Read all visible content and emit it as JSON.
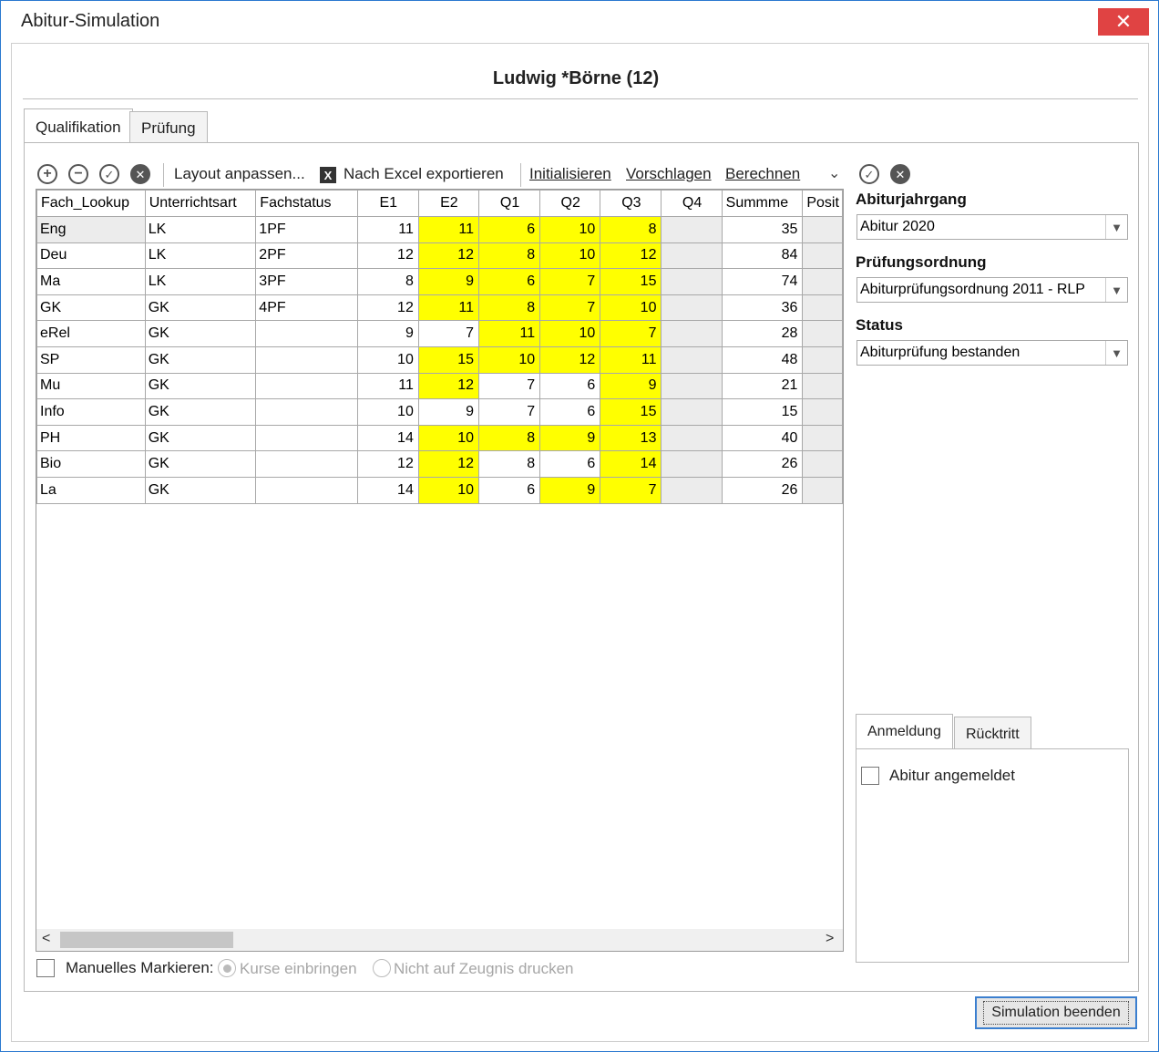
{
  "window": {
    "title": "Abitur-Simulation",
    "close_glyph": "✕"
  },
  "student": {
    "name": "Ludwig *Börne (12)"
  },
  "tabs": [
    {
      "label": "Qualifikation"
    },
    {
      "label": "Prüfung"
    }
  ],
  "toolbar": {
    "layout_label": "Layout anpassen...",
    "excel_icon": "X",
    "excel_label": "Nach Excel exportieren",
    "init_label": "Initialisieren",
    "suggest_label": "Vorschlagen",
    "calc_label": "Berechnen",
    "icons": [
      "add-icon",
      "remove-icon",
      "confirm-icon",
      "cancel-icon",
      "chevron-down-icon",
      "confirm-icon",
      "cancel-icon"
    ]
  },
  "grid": {
    "columns": [
      "Fach_Lookup",
      "Unterrichtsart",
      "Fachstatus",
      "E1",
      "E2",
      "Q1",
      "Q2",
      "Q3",
      "Q4",
      "Summme",
      "Posit"
    ],
    "rows": [
      {
        "fach": "Eng",
        "art": "LK",
        "status": "1PF",
        "E1": "11",
        "E2": "11",
        "Q1": "6",
        "Q2": "10",
        "Q3": "8",
        "Q4": "",
        "sum": "35",
        "hl": [
          false,
          true,
          true,
          true,
          true
        ]
      },
      {
        "fach": "Deu",
        "art": "LK",
        "status": "2PF",
        "E1": "12",
        "E2": "12",
        "Q1": "8",
        "Q2": "10",
        "Q3": "12",
        "Q4": "",
        "sum": "84",
        "hl": [
          false,
          true,
          true,
          true,
          true
        ]
      },
      {
        "fach": "Ma",
        "art": "LK",
        "status": "3PF",
        "E1": "8",
        "E2": "9",
        "Q1": "6",
        "Q2": "7",
        "Q3": "15",
        "Q4": "",
        "sum": "74",
        "hl": [
          false,
          true,
          true,
          true,
          true
        ]
      },
      {
        "fach": "GK",
        "art": "GK",
        "status": "4PF",
        "E1": "12",
        "E2": "11",
        "Q1": "8",
        "Q2": "7",
        "Q3": "10",
        "Q4": "",
        "sum": "36",
        "hl": [
          false,
          true,
          true,
          true,
          true
        ]
      },
      {
        "fach": "eRel",
        "art": "GK",
        "status": "",
        "E1": "9",
        "E2": "7",
        "Q1": "11",
        "Q2": "10",
        "Q3": "7",
        "Q4": "",
        "sum": "28",
        "hl": [
          false,
          false,
          true,
          true,
          true
        ]
      },
      {
        "fach": "SP",
        "art": "GK",
        "status": "",
        "E1": "10",
        "E2": "15",
        "Q1": "10",
        "Q2": "12",
        "Q3": "11",
        "Q4": "",
        "sum": "48",
        "hl": [
          false,
          true,
          true,
          true,
          true
        ]
      },
      {
        "fach": "Mu",
        "art": "GK",
        "status": "",
        "E1": "11",
        "E2": "12",
        "Q1": "7",
        "Q2": "6",
        "Q3": "9",
        "Q4": "",
        "sum": "21",
        "hl": [
          false,
          true,
          false,
          false,
          true
        ]
      },
      {
        "fach": "Info",
        "art": "GK",
        "status": "",
        "E1": "10",
        "E2": "9",
        "Q1": "7",
        "Q2": "6",
        "Q3": "15",
        "Q4": "",
        "sum": "15",
        "hl": [
          false,
          false,
          false,
          false,
          true
        ]
      },
      {
        "fach": "PH",
        "art": "GK",
        "status": "",
        "E1": "14",
        "E2": "10",
        "Q1": "8",
        "Q2": "9",
        "Q3": "13",
        "Q4": "",
        "sum": "40",
        "hl": [
          false,
          true,
          true,
          true,
          true
        ]
      },
      {
        "fach": "Bio",
        "art": "GK",
        "status": "",
        "E1": "12",
        "E2": "12",
        "Q1": "8",
        "Q2": "6",
        "Q3": "14",
        "Q4": "",
        "sum": "26",
        "hl": [
          false,
          true,
          false,
          false,
          true
        ]
      },
      {
        "fach": "La",
        "art": "GK",
        "status": "",
        "E1": "14",
        "E2": "10",
        "Q1": "6",
        "Q2": "9",
        "Q3": "7",
        "Q4": "",
        "sum": "26",
        "hl": [
          false,
          true,
          false,
          true,
          true
        ]
      }
    ],
    "highlight_color": "#ffff00",
    "scroll_left": "<",
    "scroll_right": ">"
  },
  "options": {
    "manual_label": "Manuelles Markieren:",
    "radio1": "Kurse einbringen",
    "radio2": "Nicht auf Zeugnis drucken"
  },
  "right": {
    "jahrgang_label": "Abiturjahrgang",
    "jahrgang_value": "Abitur 2020",
    "ordnung_label": "Prüfungsordnung",
    "ordnung_value": "Abiturprüfungsordnung 2011 - RLP",
    "status_label": "Status",
    "status_value": "Abiturprüfung bestanden",
    "subtabs": [
      {
        "label": "Anmeldung"
      },
      {
        "label": "Rücktritt"
      }
    ],
    "angemeldet_label": "Abitur angemeldet"
  },
  "footer": {
    "finish_label": "Simulation beenden"
  }
}
